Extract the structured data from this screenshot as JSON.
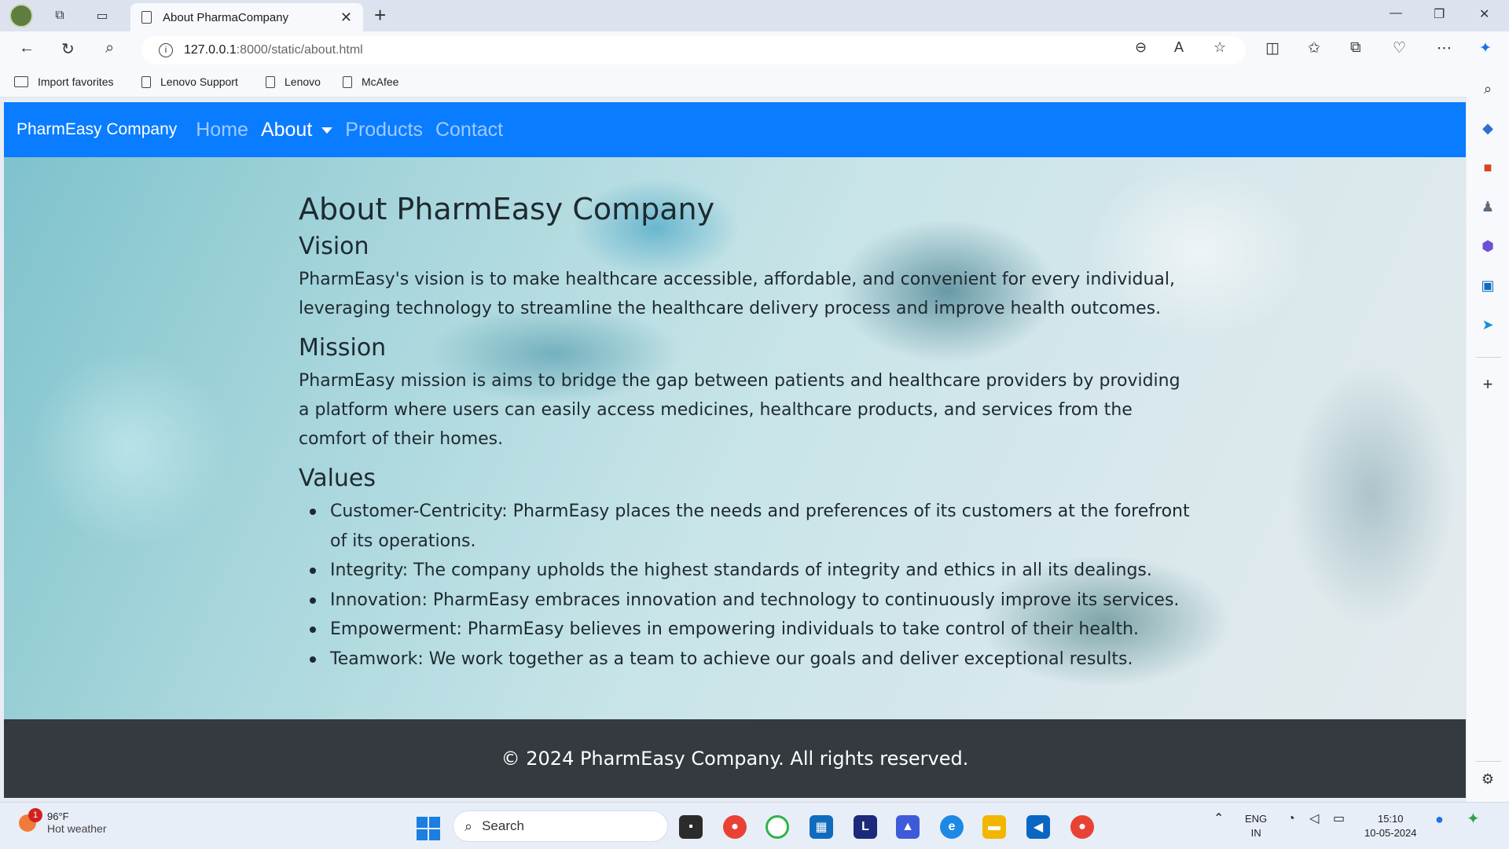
{
  "browser": {
    "tab_title": "About PharmaCompany",
    "url_host": "127.0.0.1",
    "url_path": ":8000/static/about.html",
    "favorites": [
      "Import favorites",
      "Lenovo Support",
      "Lenovo",
      "McAfee"
    ]
  },
  "site": {
    "brand": "PharmEasy Company",
    "nav": {
      "home": "Home",
      "about": "About",
      "products": "Products",
      "contact": "Contact"
    },
    "content": {
      "title": "About PharmEasy Company",
      "vision_heading": "Vision",
      "vision_text": "PharmEasy's vision is to make healthcare accessible, affordable, and convenient for every individual, leveraging technology to streamline the healthcare delivery process and improve health outcomes.",
      "mission_heading": "Mission",
      "mission_text": "PharmEasy mission is aims to bridge the gap between patients and healthcare providers by providing a platform where users can easily access medicines, healthcare products, and services from the comfort of their homes.",
      "values_heading": "Values",
      "values": [
        "Customer-Centricity: PharmEasy places the needs and preferences of its customers at the forefront of its operations.",
        "Integrity: The company upholds the highest standards of integrity and ethics in all its dealings.",
        "Innovation: PharmEasy embraces innovation and technology to continuously improve its services.",
        "Empowerment: PharmEasy believes in empowering individuals to take control of their health.",
        "Teamwork: We work together as a team to achieve our goals and deliver exceptional results."
      ]
    },
    "footer": "© 2024 PharmEasy Company. All rights reserved."
  },
  "taskbar": {
    "weather_temp": "96°F",
    "weather_desc": "Hot weather",
    "weather_badge": "1",
    "search_placeholder": "Search",
    "lang_1": "ENG",
    "lang_2": "IN",
    "time": "15:10",
    "date": "10-05-2024"
  },
  "colors": {
    "navbar": "#0a7cff",
    "footer": "#343a40"
  }
}
